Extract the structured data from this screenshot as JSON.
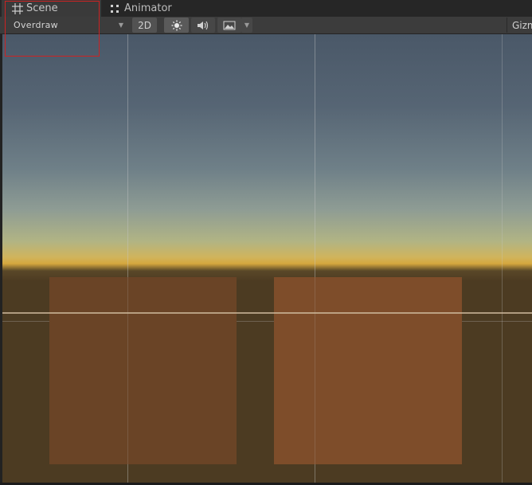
{
  "tabs": [
    {
      "label": "Scene",
      "icon": "scene-grid-icon",
      "active": true
    },
    {
      "label": "Animator",
      "icon": "animator-icon",
      "active": false
    }
  ],
  "toolbar": {
    "draw_mode": "Overdraw",
    "btn_2d": "2D",
    "lighting_icon": "sun-icon",
    "audio_icon": "speaker-icon",
    "effects_icon": "image-icon",
    "gizmos_label": "Gizm"
  },
  "colors": {
    "highlight": "#cc2222",
    "sprite_left": "#6a4426",
    "sprite_right": "#7e4d2a",
    "ground": "#4c3b22"
  }
}
